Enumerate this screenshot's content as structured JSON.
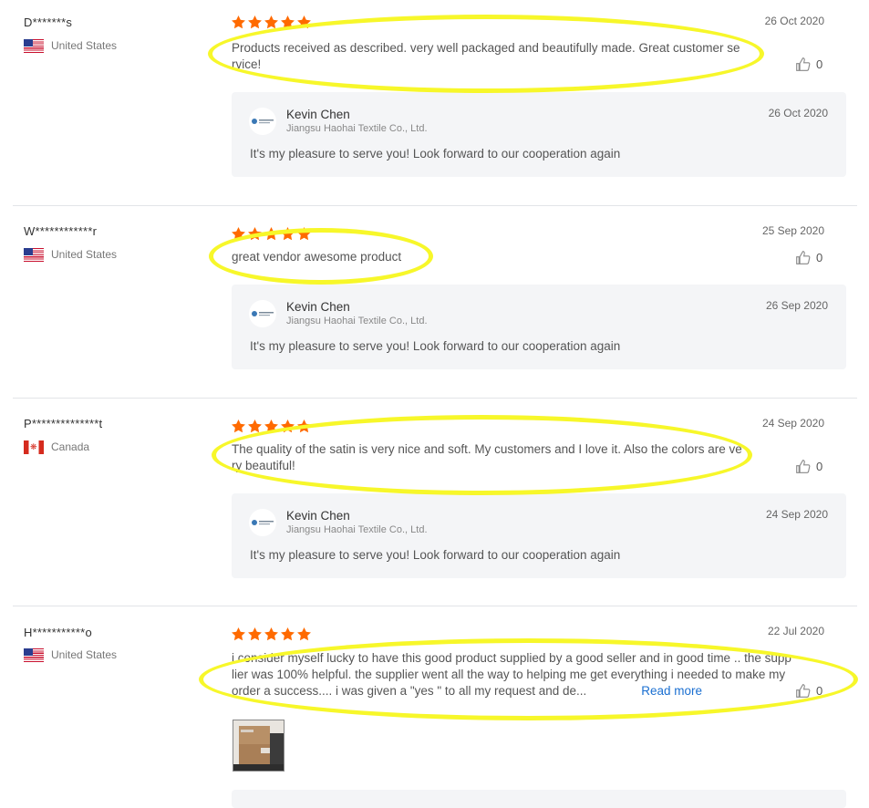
{
  "colors": {
    "star": "#ff6a00",
    "highlight": "#f7f72a",
    "link": "#1a6fd1"
  },
  "reviews": [
    {
      "buyer": "D*******s",
      "country": "United States",
      "flag": "us-flag",
      "stars": 5,
      "date": "26 Oct 2020",
      "comment": "Products received as described. very well packaged and beautifully made. Great customer service!",
      "likes": "0",
      "reply": {
        "name": "Kevin Chen",
        "company": "Jiangsu Haohai Textile Co., Ltd.",
        "date": "26 Oct 2020",
        "text": "It's my pleasure to serve you! Look forward to our cooperation again"
      }
    },
    {
      "buyer": "W************r",
      "country": "United States",
      "flag": "us-flag",
      "stars": 5,
      "date": "25 Sep 2020",
      "comment": "great vendor awesome product",
      "likes": "0",
      "reply": {
        "name": "Kevin Chen",
        "company": "Jiangsu Haohai Textile Co., Ltd.",
        "date": "26 Sep 2020",
        "text": "It's my pleasure to serve you! Look forward to our cooperation again"
      }
    },
    {
      "buyer": "P**************t",
      "country": "Canada",
      "flag": "canada-flag",
      "stars": 5,
      "date": "24 Sep 2020",
      "comment": "The quality of the satin is very nice and soft. My customers and I love it. Also the colors are very beautiful!",
      "likes": "0",
      "reply": {
        "name": "Kevin Chen",
        "company": "Jiangsu Haohai Textile Co., Ltd.",
        "date": "24 Sep 2020",
        "text": "It's my pleasure to serve you! Look forward to our cooperation again"
      }
    },
    {
      "buyer": "H***********o",
      "country": "United States",
      "flag": "us-flag",
      "stars": 5,
      "date": "22 Jul 2020",
      "comment": "i consider myself lucky to have this good product supplied by a good seller and in good time .. the supplier was 100% helpful. the supplier went all the way to helping me get everything i needed to make my order a success.... i was given a \"yes \" to all my request and de...",
      "read_more": "Read more",
      "likes": "0"
    }
  ]
}
